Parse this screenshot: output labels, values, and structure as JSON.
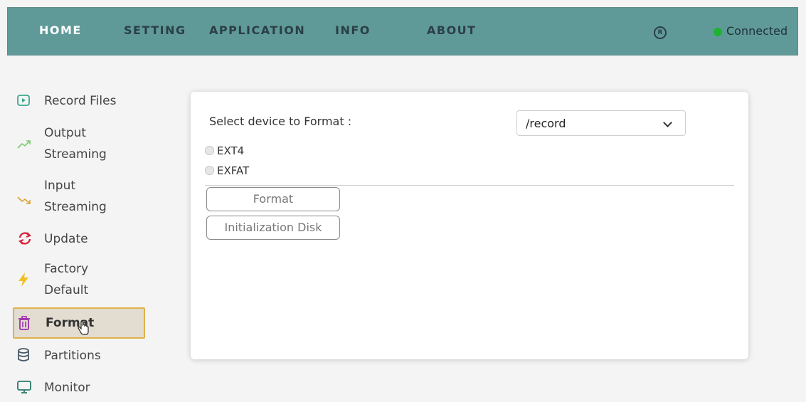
{
  "nav": {
    "items": [
      {
        "label": "HOME"
      },
      {
        "label": "SETTING"
      },
      {
        "label": "APPLICATION"
      },
      {
        "label": "INFO"
      },
      {
        "label": "ABOUT"
      }
    ],
    "status": "Connected",
    "status_color": "#1db330",
    "refresh_icon_glyph": "R"
  },
  "sidebar": {
    "items": [
      {
        "label": "Record Files",
        "icon": "play-icon"
      },
      {
        "label_line1": "Output",
        "label_line2": "Streaming",
        "icon": "trend-up-icon"
      },
      {
        "label_line1": "Input",
        "label_line2": "Streaming",
        "icon": "trend-down-icon"
      },
      {
        "label": "Update",
        "icon": "refresh-icon"
      },
      {
        "label_line1": "Factory",
        "label_line2": "Default",
        "icon": "lightning-icon"
      },
      {
        "label": "Format",
        "icon": "trash-icon",
        "active": true
      },
      {
        "label": "Partitions",
        "icon": "database-icon"
      },
      {
        "label": "Monitor",
        "icon": "monitor-icon"
      }
    ]
  },
  "format_panel": {
    "title": "Select device to Format :",
    "device_select": {
      "selected": "/record"
    },
    "filesystems": [
      {
        "label": "EXT4"
      },
      {
        "label": "EXFAT"
      }
    ],
    "format_button": "Format",
    "init_button": "Initialization Disk"
  },
  "colors": {
    "topbar": "#5f9a98",
    "active_border": "#e0b14a",
    "update_icon": "#d9233c",
    "factory_icon": "#f0c020",
    "record_icon": "#3aa88a"
  }
}
